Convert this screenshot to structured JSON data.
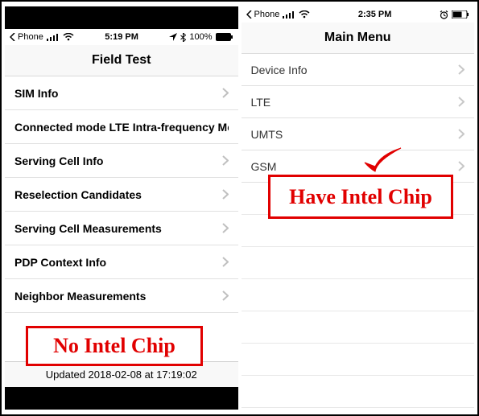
{
  "left": {
    "status": {
      "back_label": "Phone",
      "time": "5:19 PM",
      "battery": "100%"
    },
    "title": "Field Test",
    "rows": [
      {
        "label": "SIM Info"
      },
      {
        "label": "Connected mode LTE Intra-frequency Meas"
      },
      {
        "label": "Serving Cell Info"
      },
      {
        "label": "Reselection Candidates"
      },
      {
        "label": "Serving Cell Measurements"
      },
      {
        "label": "PDP Context Info"
      },
      {
        "label": "Neighbor Measurements"
      }
    ],
    "updated": "Updated 2018-02-08 at 17:19:02",
    "annotation": "No Intel Chip"
  },
  "right": {
    "status": {
      "back_label": "Phone",
      "time": "2:35 PM"
    },
    "title": "Main Menu",
    "rows": [
      {
        "label": "Device Info"
      },
      {
        "label": "LTE"
      },
      {
        "label": "UMTS"
      },
      {
        "label": "GSM"
      }
    ],
    "annotation": "Have Intel Chip"
  }
}
